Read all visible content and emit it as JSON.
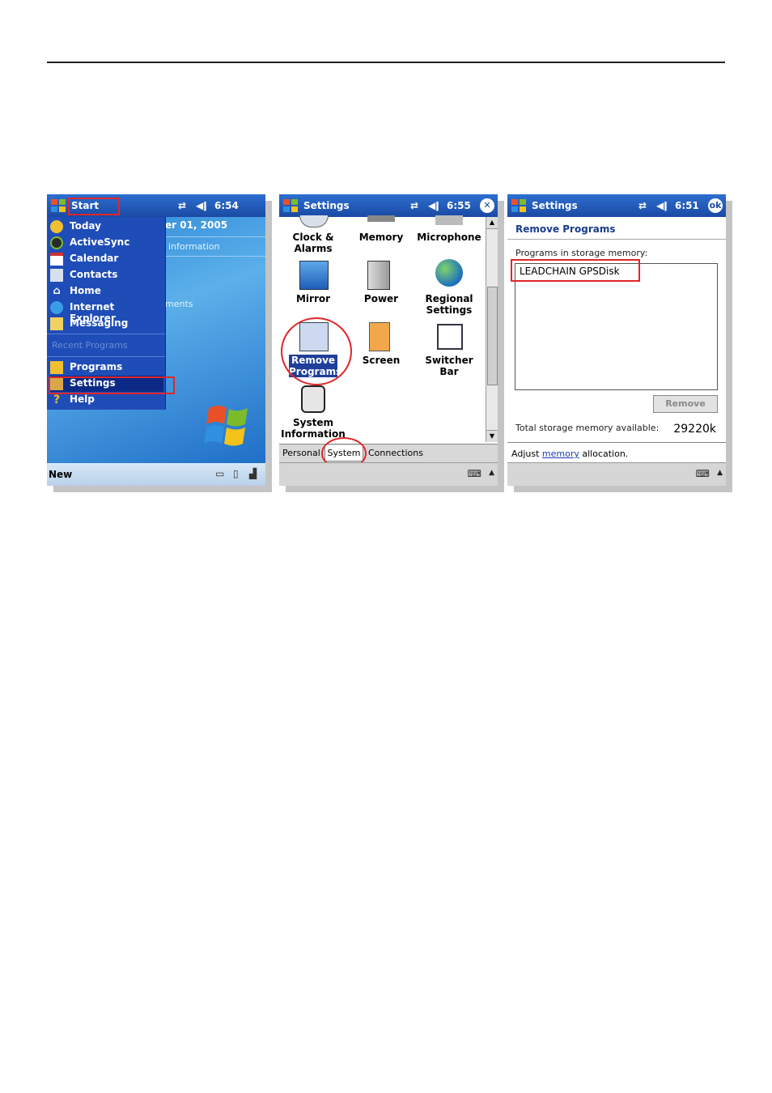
{
  "shot1": {
    "title": "Start",
    "status_time": "6:54",
    "date_fragment": "er 01, 2005",
    "info_fragment": "information",
    "ments_fragment": "ments",
    "menu_items": [
      "Today",
      "ActiveSync",
      "Calendar",
      "Contacts",
      "Home",
      "Internet Explorer",
      "Messaging"
    ],
    "recent_label": "Recent Programs",
    "lower_items": [
      "Programs",
      "Settings",
      "Help"
    ],
    "bottom_left": "New"
  },
  "shot2": {
    "title": "Settings",
    "status_time": "6:55",
    "close_glyph": "✕",
    "icons": [
      {
        "label1": "Clock &",
        "label2": "Alarms",
        "icon": "clock-icon"
      },
      {
        "label1": "Memory",
        "label2": "",
        "icon": "memory-icon"
      },
      {
        "label1": "Microphone",
        "label2": "",
        "icon": "microphone-icon"
      },
      {
        "label1": "Mirror",
        "label2": "",
        "icon": "mirror-icon"
      },
      {
        "label1": "Power",
        "label2": "",
        "icon": "power-icon"
      },
      {
        "label1": "Regional",
        "label2": "Settings",
        "icon": "globe-icon"
      },
      {
        "label1": "Remove",
        "label2": "Programs",
        "icon": "remove-programs-icon"
      },
      {
        "label1": "Screen",
        "label2": "",
        "icon": "screen-icon"
      },
      {
        "label1": "Switcher Bar",
        "label2": "",
        "icon": "switcher-bar-icon"
      },
      {
        "label1": "System",
        "label2": "Information",
        "icon": "system-info-icon"
      }
    ],
    "tabs": [
      "Personal",
      "System",
      "Connections"
    ]
  },
  "shot3": {
    "title": "Settings",
    "status_time": "6:51",
    "ok_label": "ok",
    "heading": "Remove Programs",
    "list_label": "Programs in storage memory:",
    "program": "LEADCHAIN GPSDisk",
    "remove_button": "Remove",
    "total_label": "Total storage memory available:",
    "total_value": "29220k",
    "adjust_prefix": "Adjust",
    "adjust_link": "memory",
    "adjust_suffix": "allocation."
  },
  "colors": {
    "title_bar": "#1a4aa4",
    "highlight_red": "#e0262a",
    "menu_blue": "#1f4db8"
  }
}
